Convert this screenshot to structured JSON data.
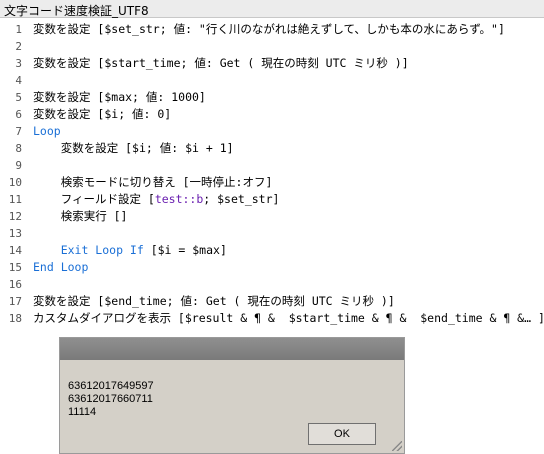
{
  "window": {
    "title": "文字コード速度検証_UTF8"
  },
  "script_lines": [
    {
      "num": "1",
      "segments": [
        {
          "text": "変数を設定 [$set_str; 値: \"行く川のながれは絶えずして、しかも本の水にあらず。\"]",
          "class": ""
        }
      ]
    },
    {
      "num": "2",
      "segments": []
    },
    {
      "num": "3",
      "segments": [
        {
          "text": "変数を設定 [$start_time; 値: Get ( 現在の時刻 UTC ミリ秒 )]",
          "class": ""
        }
      ]
    },
    {
      "num": "4",
      "segments": []
    },
    {
      "num": "5",
      "segments": [
        {
          "text": "変数を設定 [$max; 値: 1000]",
          "class": ""
        }
      ]
    },
    {
      "num": "6",
      "segments": [
        {
          "text": "変数を設定 [$i; 値: 0]",
          "class": ""
        }
      ]
    },
    {
      "num": "7",
      "segments": [
        {
          "text": "Loop",
          "class": "kw"
        }
      ]
    },
    {
      "num": "8",
      "segments": [
        {
          "text": "    変数を設定 [$i; 値: $i + 1]",
          "class": ""
        }
      ]
    },
    {
      "num": "9",
      "segments": []
    },
    {
      "num": "10",
      "segments": [
        {
          "text": "    検索モードに切り替え [一時停止:オフ]",
          "class": ""
        }
      ]
    },
    {
      "num": "11",
      "segments": [
        {
          "text": "    フィールド設定 [",
          "class": ""
        },
        {
          "text": "test::b",
          "class": "pk"
        },
        {
          "text": "; $set_str]",
          "class": ""
        }
      ]
    },
    {
      "num": "12",
      "segments": [
        {
          "text": "    検索実行 []",
          "class": ""
        }
      ]
    },
    {
      "num": "13",
      "segments": []
    },
    {
      "num": "14",
      "segments": [
        {
          "text": "    Exit Loop If",
          "class": "kw"
        },
        {
          "text": " [$i = $max]",
          "class": ""
        }
      ]
    },
    {
      "num": "15",
      "segments": [
        {
          "text": "End Loop",
          "class": "kw"
        }
      ]
    },
    {
      "num": "16",
      "segments": []
    },
    {
      "num": "17",
      "segments": [
        {
          "text": "変数を設定 [$end_time; 値: Get ( 現在の時刻 UTC ミリ秒 )]",
          "class": ""
        }
      ]
    },
    {
      "num": "18",
      "segments": [
        {
          "text": "カスタムダイアログを表示 [$result & ¶ &  $start_time & ¶ &  $end_time & ¶ &… ]",
          "class": ""
        }
      ]
    }
  ],
  "dialog": {
    "message_lines": [
      "63612017649597",
      "63612017660711",
      "11114"
    ],
    "ok_label": "OK"
  }
}
